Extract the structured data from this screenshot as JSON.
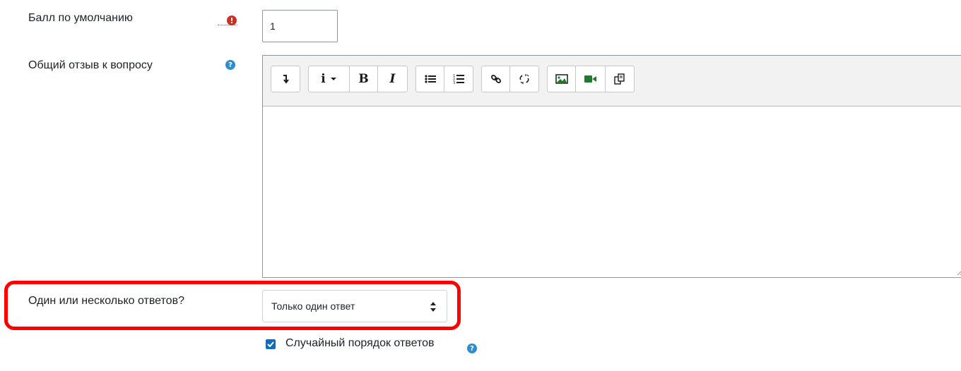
{
  "default_mark": {
    "label": "Балл по умолчанию",
    "value": "1",
    "required_icon": "exclamation-circle-icon"
  },
  "general_feedback": {
    "label": "Общий отзыв к вопросу",
    "help_icon": "question-circle-icon",
    "toolbar": {
      "buttons": [
        {
          "name": "toggle-toolbar",
          "icon": "arrow-down-icon"
        },
        {
          "name": "paragraph-style",
          "icon": "info-icon",
          "glyph": "i"
        },
        {
          "name": "bold",
          "icon": "bold-icon",
          "glyph": "B"
        },
        {
          "name": "italic",
          "icon": "italic-icon",
          "glyph": "I"
        },
        {
          "name": "unordered-list",
          "icon": "bullet-list-icon"
        },
        {
          "name": "ordered-list",
          "icon": "numbered-list-icon"
        },
        {
          "name": "link",
          "icon": "link-icon"
        },
        {
          "name": "unlink",
          "icon": "unlink-icon"
        },
        {
          "name": "image",
          "icon": "image-icon"
        },
        {
          "name": "media",
          "icon": "video-icon"
        },
        {
          "name": "manage-files",
          "icon": "files-icon"
        }
      ]
    },
    "content": ""
  },
  "single_multiple": {
    "label": "Один или несколько ответов?",
    "selected": "Только один ответ"
  },
  "shuffle_answers": {
    "label": "Случайный порядок ответов",
    "checked": true,
    "help_icon": "question-circle-icon"
  },
  "colors": {
    "highlight": "#ff0000",
    "required": "#ca3120",
    "help": "#2d8ecf",
    "toolbar_icon_green": "#1f7a2b",
    "checkbox": "#0f6cbf"
  }
}
